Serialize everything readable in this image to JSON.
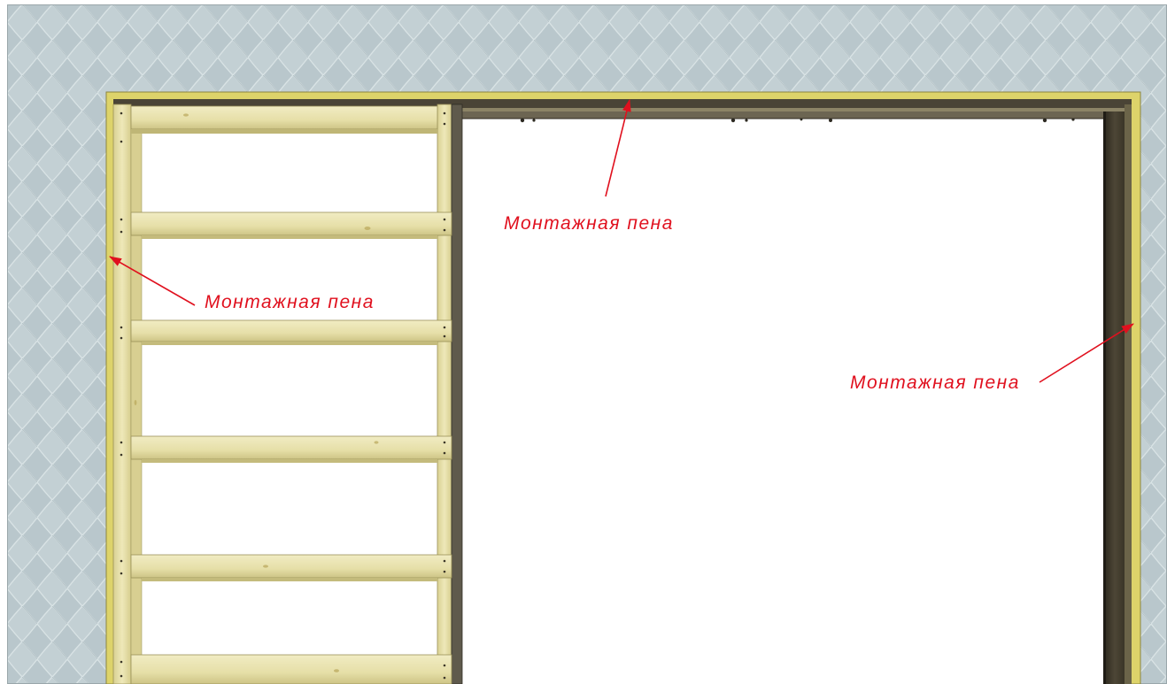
{
  "callouts": [
    {
      "id": "top",
      "label": "Монтажная пена"
    },
    {
      "id": "left",
      "label": "Монтажная пена"
    },
    {
      "id": "right",
      "label": "Монтажная пена"
    }
  ],
  "colors": {
    "wall": "#b9c7cc",
    "wall_pattern": "#cfdadd",
    "foam": "#ddd36a",
    "wood": "#e6dfaa",
    "metal": "#4a4436",
    "annotation": "#e0101e"
  },
  "icons": {
    "arrow": "red-arrow-icon"
  }
}
